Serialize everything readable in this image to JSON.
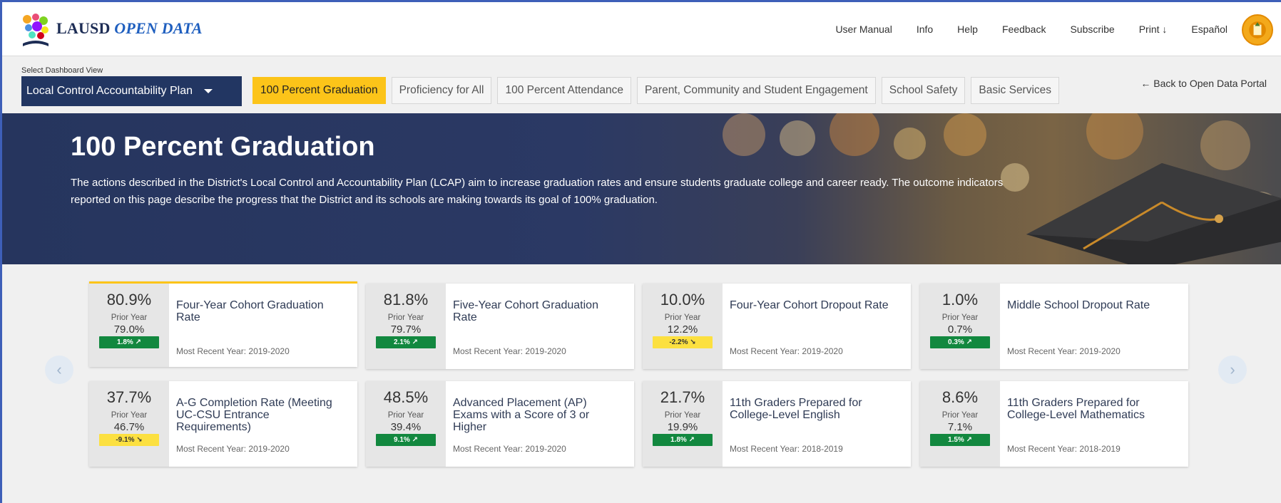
{
  "header": {
    "brand_main": "LAUSD",
    "brand_accent": "OPEN DATA",
    "nav": [
      "User Manual",
      "Info",
      "Help",
      "Feedback",
      "Subscribe",
      "Print",
      "Español"
    ]
  },
  "selector": {
    "label": "Select Dashboard View",
    "value": "Local Control Accountability Plan"
  },
  "tabs": [
    "100 Percent Graduation",
    "Proficiency for All",
    "100 Percent Attendance",
    "Parent, Community and Student Engagement",
    "School Safety",
    "Basic Services"
  ],
  "active_tab_index": 0,
  "back_link": "← Back to Open Data Portal",
  "hero": {
    "title": "100 Percent Graduation",
    "description": "The actions described in the District's Local Control and Accountability Plan (LCAP) aim to increase graduation rates and ensure students graduate college and career ready. The outcome indicators reported on this page describe the progress that the District and its schools are making towards its goal of 100% graduation."
  },
  "cards": [
    {
      "value": "80.9%",
      "prior_label": "Prior Year",
      "prior": "79.0%",
      "change": "1.8%",
      "trend": "up",
      "title": "Four-Year Cohort Graduation Rate",
      "recent": "Most Recent Year: 2019-2020"
    },
    {
      "value": "81.8%",
      "prior_label": "Prior Year",
      "prior": "79.7%",
      "change": "2.1%",
      "trend": "up",
      "title": "Five-Year Cohort Graduation Rate",
      "recent": "Most Recent Year: 2019-2020"
    },
    {
      "value": "10.0%",
      "prior_label": "Prior Year",
      "prior": "12.2%",
      "change": "-2.2%",
      "trend": "down",
      "title": "Four-Year Cohort Dropout Rate",
      "recent": "Most Recent Year: 2019-2020"
    },
    {
      "value": "1.0%",
      "prior_label": "Prior Year",
      "prior": "0.7%",
      "change": "0.3%",
      "trend": "up",
      "title": "Middle School Dropout Rate",
      "recent": "Most Recent Year: 2019-2020"
    },
    {
      "value": "37.7%",
      "prior_label": "Prior Year",
      "prior": "46.7%",
      "change": "-9.1%",
      "trend": "down",
      "title": "A-G Completion Rate (Meeting UC-CSU Entrance Requirements)",
      "recent": "Most Recent Year: 2019-2020"
    },
    {
      "value": "48.5%",
      "prior_label": "Prior Year",
      "prior": "39.4%",
      "change": "9.1%",
      "trend": "up",
      "title": "Advanced Placement (AP) Exams with a Score of 3 or Higher",
      "recent": "Most Recent Year: 2019-2020"
    },
    {
      "value": "21.7%",
      "prior_label": "Prior Year",
      "prior": "19.9%",
      "change": "1.8%",
      "trend": "up",
      "title": "11th Graders Prepared for College-Level English",
      "recent": "Most Recent Year: 2018-2019"
    },
    {
      "value": "8.6%",
      "prior_label": "Prior Year",
      "prior": "7.1%",
      "change": "1.5%",
      "trend": "up",
      "title": "11th Graders Prepared for College-Level Mathematics",
      "recent": "Most Recent Year: 2018-2019"
    }
  ],
  "colors": {
    "navy": "#223662",
    "active_tab": "#fcc419",
    "positive": "#12883f",
    "negative": "#fce040"
  },
  "icons": {
    "prev": "chevron-left-icon",
    "next": "chevron-right-icon",
    "print": "arrow-down-icon"
  }
}
